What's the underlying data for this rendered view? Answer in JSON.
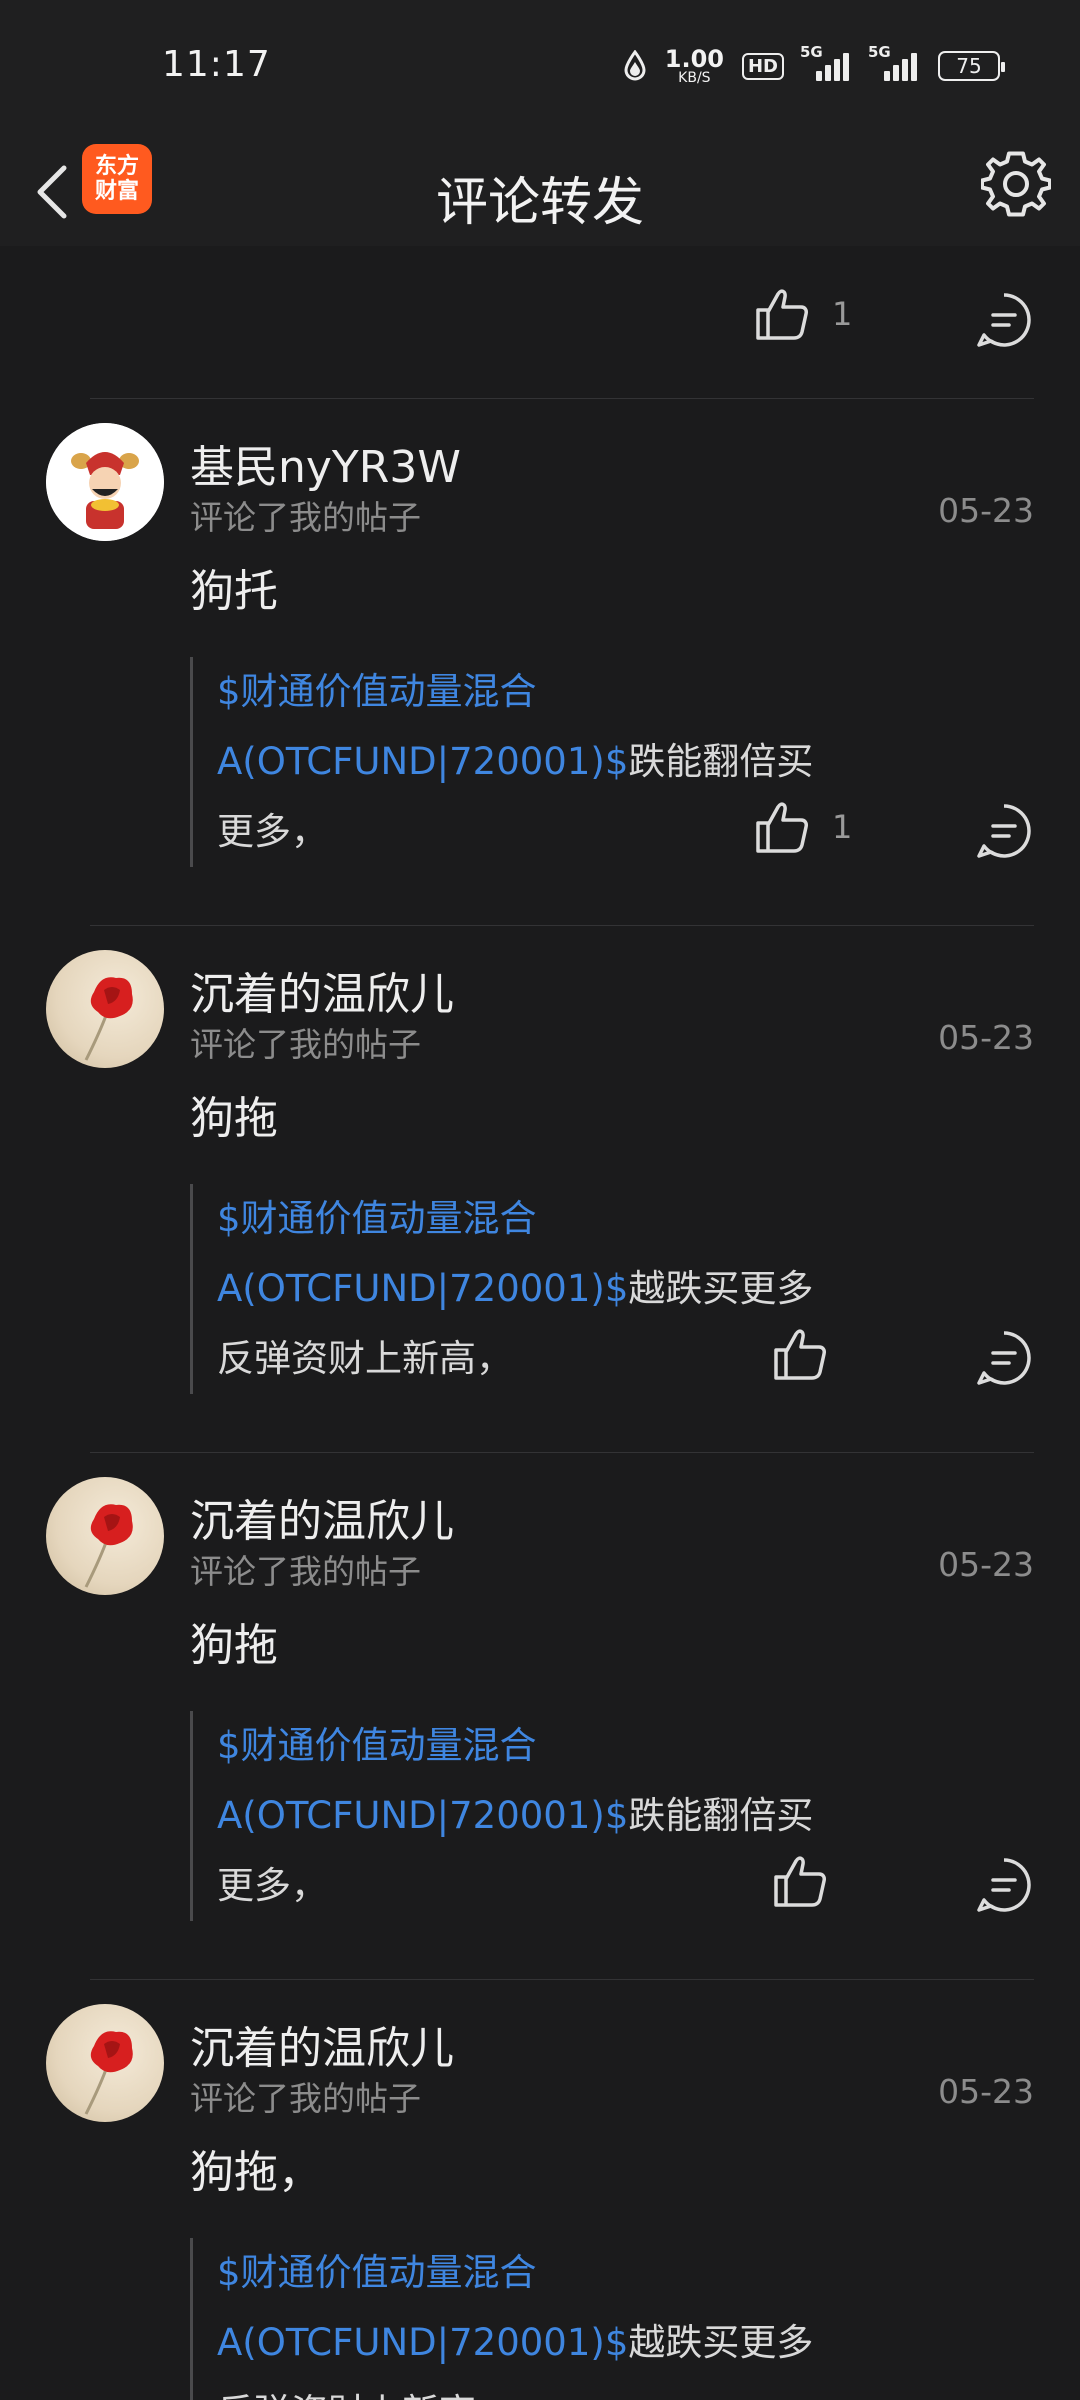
{
  "status_bar": {
    "time": "11:17",
    "net_speed_value": "1.00",
    "net_speed_unit": "KB/S",
    "hd_label": "HD",
    "signal1_label": "5G",
    "signal2_label": "5G",
    "battery": "75"
  },
  "header": {
    "logo_line1": "东方",
    "logo_line2": "财富",
    "title": "评论转发"
  },
  "partial_top": {
    "like_count": "1"
  },
  "items": [
    {
      "user": "基民nyYR3W",
      "action": "评论了我的帖子",
      "date": "05-23",
      "comment": "狗托",
      "quote_fund": "$财通价值动量混合A(OTCFUND|720001)$",
      "quote_text": "跌能翻倍买更多，",
      "like_count": "1"
    },
    {
      "user": "沉着的温欣儿",
      "action": "评论了我的帖子",
      "date": "05-23",
      "comment": "狗拖",
      "quote_fund": "$财通价值动量混合A(OTCFUND|720001)$",
      "quote_text": "越跌买更多反弹资财上新高，",
      "like_count": ""
    },
    {
      "user": "沉着的温欣儿",
      "action": "评论了我的帖子",
      "date": "05-23",
      "comment": "狗拖",
      "quote_fund": "$财通价值动量混合A(OTCFUND|720001)$",
      "quote_text": "跌能翻倍买更多，",
      "like_count": ""
    },
    {
      "user": "沉着的温欣儿",
      "action": "评论了我的帖子",
      "date": "05-23",
      "comment": "狗拖，",
      "quote_fund": "$财通价值动量混合A(OTCFUND|720001)$",
      "quote_text": "越跌买更多反弹资财上新高，",
      "like_count": ""
    }
  ]
}
